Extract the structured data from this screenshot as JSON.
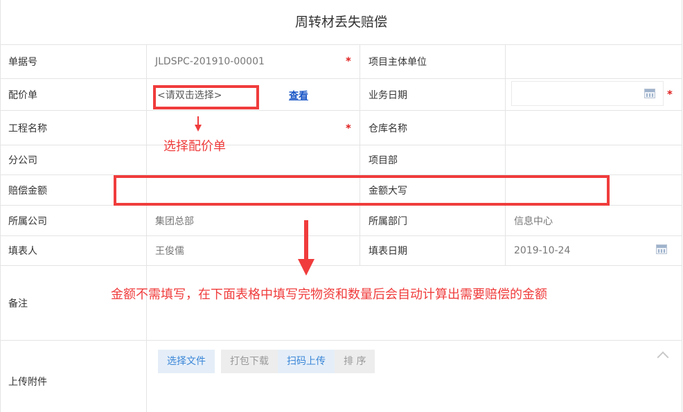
{
  "title": "周转材丢失赔偿",
  "fields": {
    "doc_no": {
      "label": "单据号",
      "value": "JLDSPC-201910-00001"
    },
    "project_unit": {
      "label": "项目主体单位",
      "value": ""
    },
    "quote": {
      "label": "配价单",
      "placeholder": "<请双击选择>",
      "link": "查看"
    },
    "biz_date": {
      "label": "业务日期",
      "value": ""
    },
    "project_name": {
      "label": "工程名称",
      "value": ""
    },
    "warehouse": {
      "label": "仓库名称",
      "value": ""
    },
    "branch": {
      "label": "分公司",
      "value": ""
    },
    "project_dept": {
      "label": "项目部",
      "value": ""
    },
    "amount": {
      "label": "赔偿金额",
      "value": ""
    },
    "amount_upper": {
      "label": "金额大写",
      "value": ""
    },
    "company": {
      "label": "所属公司",
      "value": "集团总部"
    },
    "department": {
      "label": "所属部门",
      "value": "信息中心"
    },
    "filler": {
      "label": "填表人",
      "value": "王俊儒"
    },
    "fill_date": {
      "label": "填表日期",
      "value": "2019-10-24"
    },
    "remark": {
      "label": "备注",
      "value": ""
    },
    "attachment": {
      "label": "上传附件"
    }
  },
  "required_mark": "*",
  "buttons": {
    "choose_file": "选择文件",
    "pack_download": "打包下载",
    "scan_upload": "扫码上传",
    "sort": "排 序"
  },
  "annotations": {
    "select_quote": "选择配价单",
    "amount_note": "金额不需填写，在下面表格中填写完物资和数量后会自动计算出需要赔偿的金额"
  },
  "colors": {
    "annotation": "#f03c3c",
    "link": "#1a56c6",
    "required": "#e02020"
  },
  "icons": {
    "calendar": "calendar-icon",
    "collapse": "chevron-up-icon"
  }
}
